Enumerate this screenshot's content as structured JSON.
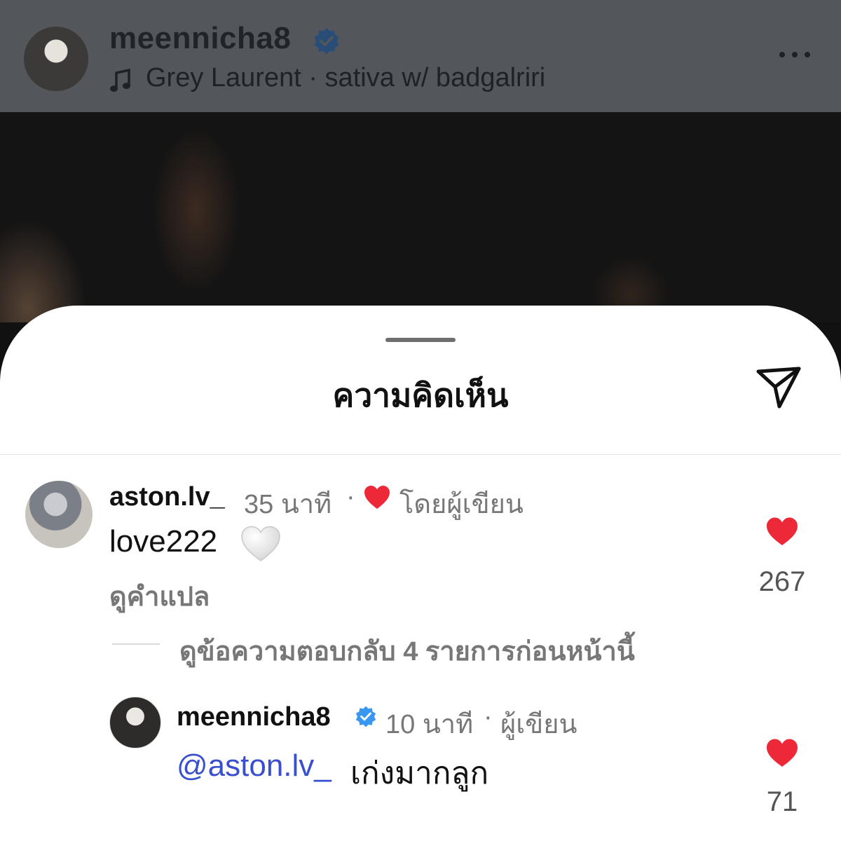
{
  "header": {
    "username": "meennicha8",
    "music_icon": "music-note-icon",
    "song": "Grey Laurent · sativa w/ badgalriri",
    "more_icon": "more-horizontal-icon"
  },
  "sheet": {
    "title": "ความคิดเห็น",
    "share_icon": "send-icon"
  },
  "comments": [
    {
      "username": "aston.lv_",
      "time": "35 นาที",
      "separator": "·",
      "author_liked_label": "โดยผู้เขียน",
      "text": "love222",
      "translate_label": "ดูคำแปล",
      "likes": "267",
      "view_replies_label": "ดูข้อความตอบกลับ 4 รายการก่อนหน้านี้"
    },
    {
      "username": "meennicha8",
      "time": "10 นาที",
      "separator": "·",
      "author_label": "ผู้เขียน",
      "mention": "@aston.lv_",
      "text": "เก่งมากลูก",
      "likes": "71"
    }
  ],
  "colors": {
    "like_red": "#ed2939",
    "verified_blue": "#3897f0",
    "mention_blue": "#3a4fcf"
  }
}
